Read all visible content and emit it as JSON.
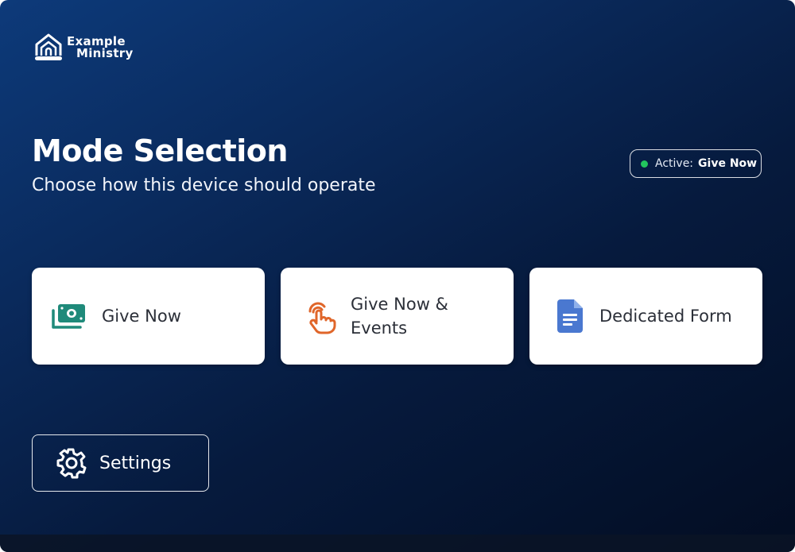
{
  "brand": {
    "name_line1": "Example",
    "name_line2": "Ministry",
    "logo_icon": "church-building-icon"
  },
  "header": {
    "title": "Mode Selection",
    "subtitle": "Choose how this device should operate"
  },
  "status": {
    "label": "Active:",
    "value": "Give Now",
    "indicator_color": "#22c55e"
  },
  "modes": [
    {
      "label": "Give Now",
      "icon": "money-stack-icon",
      "icon_color": "#1f8a7a"
    },
    {
      "label": "Give Now & Events",
      "icon": "tap-hand-icon",
      "icon_color": "#e0662a"
    },
    {
      "label": "Dedicated Form",
      "icon": "document-icon",
      "icon_color": "#4a78d0"
    }
  ],
  "settings": {
    "label": "Settings",
    "icon": "gear-icon"
  },
  "colors": {
    "background_top": "#0d3a7a",
    "background_bottom": "#030d22",
    "card_background": "#ffffff",
    "card_text": "#2b2f38"
  }
}
